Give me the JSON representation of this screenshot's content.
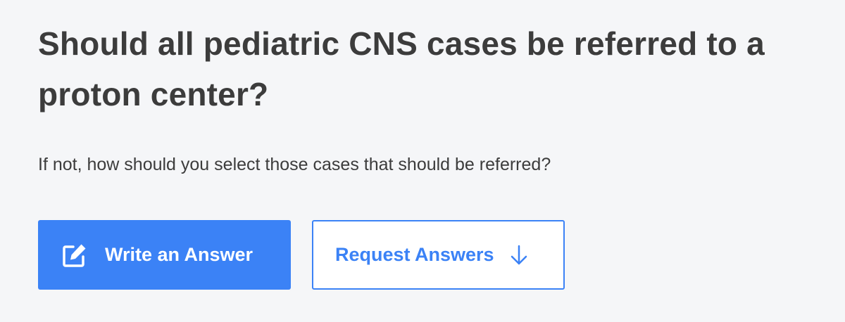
{
  "question": {
    "title": "Should all pediatric CNS cases be referred to a proton center?",
    "subtitle": "If not, how should you select those cases that should be referred?"
  },
  "actions": {
    "write_answer_label": "Write an Answer",
    "write_answer_icon": "edit-icon",
    "request_answers_label": "Request Answers",
    "request_answers_icon": "arrow-down-icon"
  },
  "colors": {
    "accent": "#3b82f6",
    "background": "#f5f6f8",
    "text": "#3c3c3c"
  }
}
